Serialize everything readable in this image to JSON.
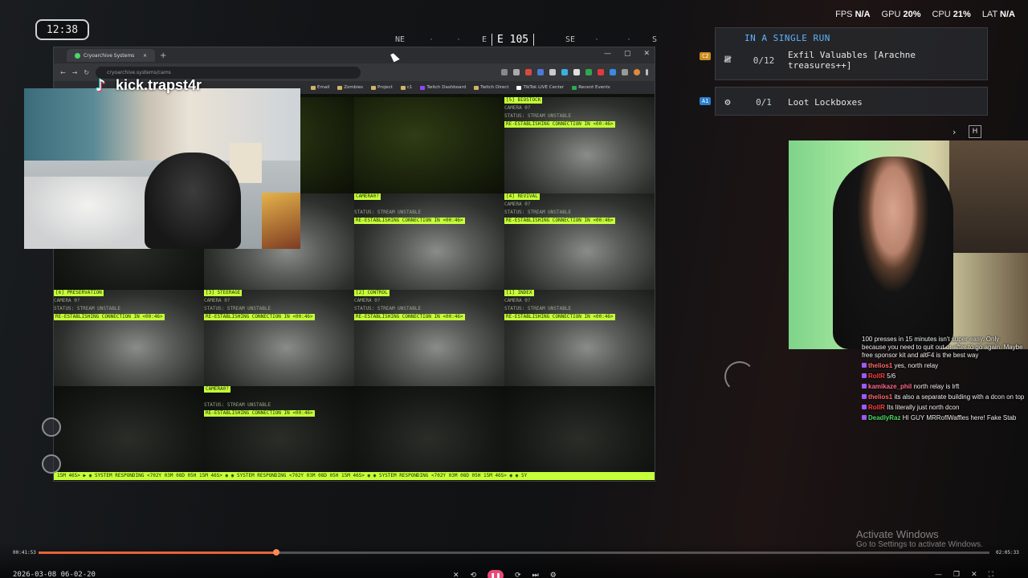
{
  "hud": {
    "clock": "12:38",
    "compass": {
      "heading": "E 105",
      "labels": [
        "NE",
        "E",
        "SE",
        "S"
      ]
    },
    "stats": [
      {
        "label": "FPS",
        "value": "N/A"
      },
      {
        "label": "GPU",
        "value": "20%"
      },
      {
        "label": "CPU",
        "value": "21%"
      },
      {
        "label": "LAT",
        "value": "N/A"
      }
    ],
    "quest": {
      "header": "IN A SINGLE RUN",
      "items": [
        {
          "badge": "C2",
          "badge_color": "#c98a1c",
          "count": "0/12",
          "label": "Exfil Valuables [Arachne treasures++]"
        },
        {
          "badge": "A1",
          "badge_color": "#2a7fd0",
          "count": "0/1",
          "label": "Loot Lockboxes"
        }
      ],
      "key_hint": "H"
    }
  },
  "browser": {
    "tab_title": "Cryoarchive Systems",
    "url": "cryoarchive.systems/cams",
    "bookmarks": [
      "Email",
      "Zombies",
      "Project",
      "c1",
      "Twitch Dashboard",
      "Twitch Direct",
      "TikTok LIVE Center",
      "Recent Events"
    ],
    "statusbar": "15M 46S> ▶ ◉ SYSTEM RESPONDING <702Y 03M 08D 05H 15M 46S> ◉ ◉ SYSTEM RESPONDING <702Y 03M 08D 05H 15M 46S> ◉ ◉ SYSTEM RESPONDING <702Y 03M 08D 05H 15M 46S> ◉ ◉ SY"
  },
  "cameras": [
    {
      "name": "",
      "camera": "",
      "status": "",
      "conn": "",
      "feed": "green"
    },
    {
      "name": "",
      "camera": "",
      "status": "",
      "conn": "",
      "feed": "green"
    },
    {
      "name": "",
      "camera": "",
      "status": "",
      "conn": "",
      "feed": "green"
    },
    {
      "name": "[5] BIOSTOCK",
      "camera": "CAMERA 0?",
      "status": "STATUS: STREAM UNSTABLE",
      "conn": "RE-ESTABLISHING CONNECTION IN <00:46>",
      "feed": "gray"
    },
    {
      "name": "",
      "camera": "",
      "status": "",
      "conn": "",
      "feed": "dark"
    },
    {
      "name": "",
      "camera": "",
      "status": "",
      "conn": "IN <00:46>",
      "feed": "gray"
    },
    {
      "name": "CAMERA0?",
      "camera": "",
      "status": "STATUS: STREAM UNSTABLE",
      "conn": "RE-ESTABLISHING CONNECTION IN <00:46>",
      "feed": "gray"
    },
    {
      "name": "[4] REVIVAL",
      "camera": "CAMERA 0?",
      "status": "STATUS: STREAM UNSTABLE",
      "conn": "RE-ESTABLISHING CONNECTION IN <00:46>",
      "feed": "gray"
    },
    {
      "name": "[6] PRESERVATION",
      "camera": "CAMERA 0?",
      "status": "STATUS: STREAM UNSTABLE",
      "conn": "RE-ESTABLISHING CONNECTION IN <00:46>",
      "feed": "gray"
    },
    {
      "name": "[3] STEERAGE",
      "camera": "CAMERA 0?",
      "status": "STATUS: STREAM UNSTABLE",
      "conn": "RE-ESTABLISHING CONNECTION IN <00:46>",
      "feed": "gray"
    },
    {
      "name": "[2] CONTROL",
      "camera": "CAMERA 0?",
      "status": "STATUS: STREAM UNSTABLE",
      "conn": "RE-ESTABLISHING CONNECTION IN <00:46>",
      "feed": "gray"
    },
    {
      "name": "[1] INDEX",
      "camera": "CAMERA 0?",
      "status": "STATUS: STREAM UNSTABLE",
      "conn": "RE-ESTABLISHING CONNECTION IN <00:46>",
      "feed": "gray"
    },
    {
      "name": "",
      "camera": "",
      "status": "",
      "conn": "",
      "feed": "dark"
    },
    {
      "name": "CAMERA0?",
      "camera": "",
      "status": "STATUS: STREAM UNSTABLE",
      "conn": "RE-ESTABLISHING CONNECTION IN <00:46>",
      "feed": "dark"
    },
    {
      "name": "",
      "camera": "",
      "status": "",
      "conn": "",
      "feed": "dark"
    },
    {
      "name": "",
      "camera": "",
      "status": "",
      "conn": "",
      "feed": "dark"
    }
  ],
  "overlay": {
    "platform_icon": "tiktok-icon",
    "handle": "kick.trapst4r"
  },
  "chat": [
    {
      "user": "",
      "color": "#ffffff",
      "text": "100 presses in 15 minutes isn't super easy. Only because you need to quit out or after to go again. Maybe free sponsor kit and altF4 is the best way"
    },
    {
      "user": "thelios1",
      "color": "#ff6a6a",
      "text": "yes, north relay"
    },
    {
      "user": "RollR",
      "color": "#ff4040",
      "text": "5/6"
    },
    {
      "user": "kamikaze_phil",
      "color": "#ff6a8a",
      "text": "north relay is lrft"
    },
    {
      "user": "thelios1",
      "color": "#ff6a6a",
      "text": "its also a separate building with a dcon on top"
    },
    {
      "user": "RollR",
      "color": "#ff4040",
      "text": "Its literally just north dcon"
    },
    {
      "user": "DeadlyRaz",
      "color": "#4cd964",
      "text": "HI GUY MRRoflWaffles here! Fake Stab"
    }
  ],
  "windows_watermark": {
    "line1": "Activate Windows",
    "line2": "Go to Settings to activate Windows."
  },
  "player": {
    "current_time": "00:41:53",
    "total_time": "02:05:33",
    "progress": 0.25,
    "date": "2026-03-08 06-02-20"
  }
}
